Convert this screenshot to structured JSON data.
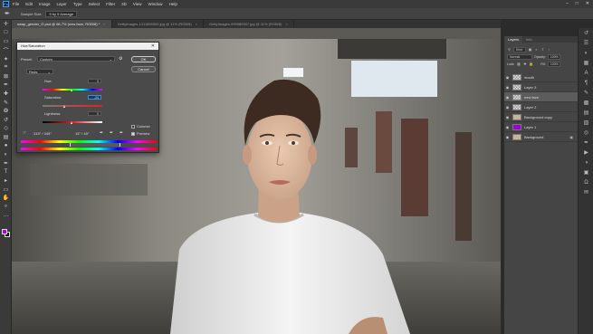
{
  "app": {
    "menus": [
      "File",
      "Edit",
      "Image",
      "Layer",
      "Type",
      "Select",
      "Filter",
      "3D",
      "View",
      "Window",
      "Help"
    ]
  },
  "options_bar": {
    "sample_size_label": "Sample Size:",
    "sample_size_value": "5 by 5 Average"
  },
  "tabs": [
    {
      "label": "swap_gender_G.psd @ 66.7% (new face, RGB/8) *",
      "active": true
    },
    {
      "label": "GettyImages-1311855500.jpg @ 11% (RGB/8)",
      "active": false
    },
    {
      "label": "GettyImages-999589347.jpg @ 11% (RGB/8)",
      "active": false
    }
  ],
  "layers_panel": {
    "tabs": [
      "Layers",
      "Info"
    ],
    "kind_label": "Kind",
    "blend_mode": "Normal",
    "opacity_label": "Opacity:",
    "opacity_value": "100%",
    "lock_label": "Lock:",
    "fill_label": "Fill:",
    "fill_value": "100%",
    "layers": [
      {
        "name": "mouth",
        "thumb": "checker",
        "selected": false
      },
      {
        "name": "Layer 3",
        "thumb": "checker",
        "selected": false
      },
      {
        "name": "new face",
        "thumb": "checker",
        "selected": true
      },
      {
        "name": "Layer 2",
        "thumb": "checker",
        "selected": false
      },
      {
        "name": "Background copy",
        "thumb": "photo",
        "selected": false
      },
      {
        "name": "Layer 1",
        "thumb": "purple",
        "selected": false
      },
      {
        "name": "Background",
        "thumb": "photo",
        "selected": false
      }
    ]
  },
  "dialog": {
    "title": "Hue/Saturation",
    "preset_label": "Preset:",
    "preset_value": "Custom",
    "ok_label": "OK",
    "cancel_label": "Cancel",
    "channel_value": "Reds",
    "hue_label": "Hue:",
    "hue_value": "0",
    "saturation_label": "Saturation:",
    "saturation_value": "-24",
    "lightness_label": "Lightness:",
    "lightness_value": "0",
    "colorize_label": "Colorize",
    "colorize_checked": false,
    "preview_label": "Preview",
    "preview_checked": true,
    "range_left": "315° / 345°",
    "range_right": "15° \\ 45°",
    "hue_level": 0.5,
    "saturation_level": 0.38,
    "lightness_level": 0.5
  },
  "colors": {
    "foreground": "#b100e8",
    "background": "#111111",
    "accent": "#31a8ff"
  },
  "icons": {
    "tools": [
      "move-icon",
      "artboard-icon",
      "marquee-icon",
      "lasso-icon",
      "quick-select-icon",
      "crop-icon",
      "frame-icon",
      "eyedropper-icon",
      "healing-icon",
      "brush-icon",
      "stamp-icon",
      "history-brush-icon",
      "eraser-icon",
      "gradient-icon",
      "blur-icon",
      "dodge-icon",
      "pen-icon",
      "type-icon",
      "path-select-icon",
      "rectangle-icon",
      "hand-icon",
      "zoom-icon",
      "more-icon"
    ],
    "right_strip": [
      "history-icon",
      "properties-icon",
      "adjustments-icon",
      "libraries-icon",
      "character-icon",
      "paragraph-icon",
      "brushes-icon",
      "swatches-icon",
      "gradients-icon",
      "patterns-icon",
      "channels-icon",
      "paths-icon",
      "actions-icon",
      "color-icon",
      "navigator-icon",
      "glyphs-icon",
      "notes-icon"
    ]
  }
}
